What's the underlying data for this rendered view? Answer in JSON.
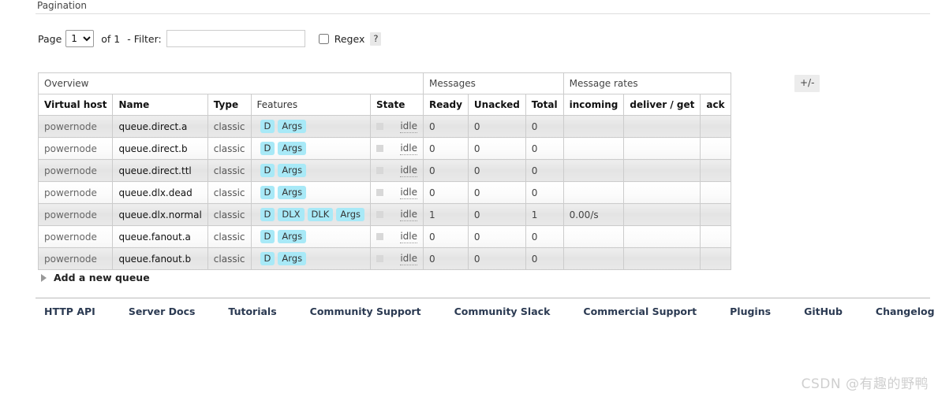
{
  "pagination": {
    "heading": "Pagination",
    "page_label": "Page",
    "page_value": "1",
    "page_options": [
      "1"
    ],
    "of_text": "of 1",
    "dash": "-",
    "filter_label": "Filter:",
    "filter_value": "",
    "filter_placeholder": "",
    "regex_label": "Regex",
    "regex_checked": false,
    "help_label": "?"
  },
  "table": {
    "group_headers": [
      {
        "label": "Overview",
        "span": 5
      },
      {
        "label": "Messages",
        "span": 3
      },
      {
        "label": "Message rates",
        "span": 3
      }
    ],
    "columns": [
      {
        "label": "Virtual host",
        "bold": true,
        "align": "left"
      },
      {
        "label": "Name",
        "bold": true,
        "align": "left"
      },
      {
        "label": "Type",
        "bold": true,
        "align": "left"
      },
      {
        "label": "Features",
        "bold": false,
        "align": "left"
      },
      {
        "label": "State",
        "bold": true,
        "align": "left"
      },
      {
        "label": "Ready",
        "bold": true,
        "align": "right"
      },
      {
        "label": "Unacked",
        "bold": true,
        "align": "right"
      },
      {
        "label": "Total",
        "bold": true,
        "align": "right"
      },
      {
        "label": "incoming",
        "bold": true,
        "align": "right"
      },
      {
        "label": "deliver / get",
        "bold": true,
        "align": "right"
      },
      {
        "label": "ack",
        "bold": true,
        "align": "right"
      }
    ],
    "column_toggle_label": "+/-",
    "rows": [
      {
        "vhost": "powernode",
        "name": "queue.direct.a",
        "type": "classic",
        "features": [
          "D",
          "Args"
        ],
        "state": "idle",
        "ready": "0",
        "unacked": "0",
        "total": "0",
        "incoming": "",
        "deliver_get": "",
        "ack": ""
      },
      {
        "vhost": "powernode",
        "name": "queue.direct.b",
        "type": "classic",
        "features": [
          "D",
          "Args"
        ],
        "state": "idle",
        "ready": "0",
        "unacked": "0",
        "total": "0",
        "incoming": "",
        "deliver_get": "",
        "ack": ""
      },
      {
        "vhost": "powernode",
        "name": "queue.direct.ttl",
        "type": "classic",
        "features": [
          "D",
          "Args"
        ],
        "state": "idle",
        "ready": "0",
        "unacked": "0",
        "total": "0",
        "incoming": "",
        "deliver_get": "",
        "ack": ""
      },
      {
        "vhost": "powernode",
        "name": "queue.dlx.dead",
        "type": "classic",
        "features": [
          "D",
          "Args"
        ],
        "state": "idle",
        "ready": "0",
        "unacked": "0",
        "total": "0",
        "incoming": "",
        "deliver_get": "",
        "ack": ""
      },
      {
        "vhost": "powernode",
        "name": "queue.dlx.normal",
        "type": "classic",
        "features": [
          "D",
          "DLX",
          "DLK",
          "Args"
        ],
        "state": "idle",
        "ready": "1",
        "unacked": "0",
        "total": "1",
        "incoming": "0.00/s",
        "deliver_get": "",
        "ack": ""
      },
      {
        "vhost": "powernode",
        "name": "queue.fanout.a",
        "type": "classic",
        "features": [
          "D",
          "Args"
        ],
        "state": "idle",
        "ready": "0",
        "unacked": "0",
        "total": "0",
        "incoming": "",
        "deliver_get": "",
        "ack": ""
      },
      {
        "vhost": "powernode",
        "name": "queue.fanout.b",
        "type": "classic",
        "features": [
          "D",
          "Args"
        ],
        "state": "idle",
        "ready": "0",
        "unacked": "0",
        "total": "0",
        "incoming": "",
        "deliver_get": "",
        "ack": ""
      }
    ]
  },
  "add_queue": {
    "label": "Add a new queue",
    "icon": "triangle-right-icon"
  },
  "footer": {
    "links": [
      "HTTP API",
      "Server Docs",
      "Tutorials",
      "Community Support",
      "Community Slack",
      "Commercial Support",
      "Plugins",
      "GitHub",
      "Changelog"
    ]
  },
  "watermark": {
    "text": "CSDN @有趣的野鸭"
  },
  "colors": {
    "badge_bg": "#a8e9f7",
    "footer_link": "#2b3a52",
    "row_odd": "#e8e8e8",
    "row_even": "#fcfcfc",
    "border": "#cccccc",
    "watermark": "#cfcfcf"
  }
}
